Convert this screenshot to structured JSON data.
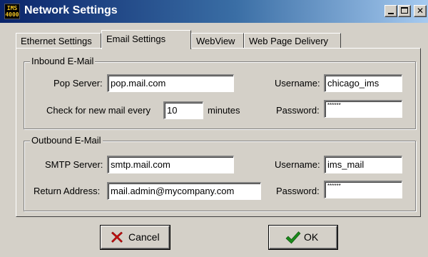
{
  "window": {
    "title": "Network Settings",
    "icon_text_top": "IMS",
    "icon_text_bottom": "4000"
  },
  "tabs": [
    {
      "label": "Ethernet Settings",
      "active": false
    },
    {
      "label": "Email Settings",
      "active": true
    },
    {
      "label": "WebView",
      "active": false
    },
    {
      "label": "Web Page Delivery",
      "active": false
    }
  ],
  "inbound": {
    "legend": "Inbound E-Mail",
    "pop_server_label": "Pop Server:",
    "pop_server_value": "pop.mail.com",
    "check_label": "Check for new mail every",
    "check_value": "10",
    "check_unit": "minutes",
    "username_label": "Username:",
    "username_value": "chicago_ims",
    "password_label": "Password:",
    "password_value": "******"
  },
  "outbound": {
    "legend": "Outbound E-Mail",
    "smtp_server_label": "SMTP Server:",
    "smtp_server_value": "smtp.mail.com",
    "return_label": "Return Address:",
    "return_value": "mail.admin@mycompany.com",
    "username_label": "Username:",
    "username_value": "ims_mail",
    "password_label": "Password:",
    "password_value": "******"
  },
  "buttons": {
    "cancel_label": "Cancel",
    "ok_label": "OK"
  },
  "icons": {
    "cancel": "red-x-icon",
    "ok": "green-check-icon",
    "close": "close-icon",
    "minimize": "minimize-icon",
    "maximize": "maximize-icon"
  },
  "colors": {
    "titlebar_start": "#0a246a",
    "titlebar_end": "#a6caf0",
    "face": "#d4d0c8",
    "cancel_icon": "#cc1111",
    "ok_icon": "#1a8a1a"
  }
}
